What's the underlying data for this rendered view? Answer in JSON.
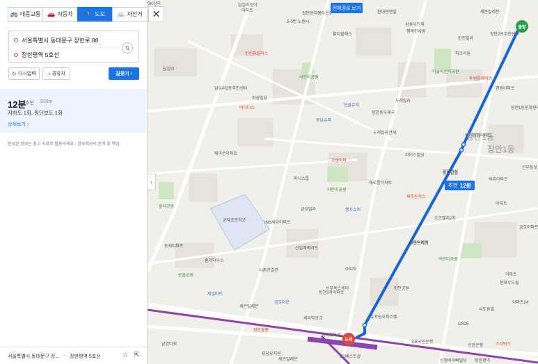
{
  "modes": [
    {
      "label": "대중교통",
      "icon": "bus-icon",
      "glyph": "🚌",
      "active": false
    },
    {
      "label": "자동차",
      "icon": "car-icon",
      "glyph": "🚗",
      "active": false
    },
    {
      "label": "도보",
      "icon": "walk-icon",
      "glyph": "🚶",
      "active": true
    },
    {
      "label": "자전거",
      "icon": "bicycle-icon",
      "glyph": "🚲",
      "active": false
    }
  ],
  "route": {
    "origin": "서울특별시 동대문구 장한로 88",
    "destination": "장한평역 5호선"
  },
  "buttons": {
    "reset": "다시입력",
    "waypoint": "경유지",
    "find": "길찾기"
  },
  "result": {
    "time": "12분",
    "recommended": "추천",
    "distance": "839m",
    "subtitle": "지하도 1회, 횡단보도 1회",
    "detail": "상세보기"
  },
  "notice": "안내된 정보는 참고 자료로 활용하세요 › 정보제공의 한계 및 책임",
  "footer": {
    "from": "서울특별시 동대문구 장...",
    "arrow": "→",
    "to": "장한평역 5호선"
  },
  "map": {
    "all_route_label": "전체경로 보기",
    "badge_rec": "추천",
    "badge_time": "12분",
    "start_label": "출발",
    "end_label": "도착",
    "district": "장안1동",
    "colors": {
      "route": "#1565d8",
      "subway_line5": "#8e44ad",
      "accent": "#1a73e8"
    },
    "labels": [
      {
        "text": "답십리동아",
        "cls": ""
      },
      {
        "text": "아파트",
        "cls": ""
      },
      {
        "text": "한신휴플러스",
        "cls": "red"
      },
      {
        "text": "장안현대홈타운1",
        "cls": ""
      },
      {
        "text": "현대썬앤빌",
        "cls": ""
      },
      {
        "text": "5-0번 노원시",
        "cls": ""
      },
      {
        "text": "황지클래스",
        "cls": ""
      },
      {
        "text": "삼성사진재",
        "cls": ""
      },
      {
        "text": "행복한사람",
        "cls": ""
      },
      {
        "text": "한진빌라",
        "cls": ""
      },
      {
        "text": "이솔어린이공원",
        "cls": "green"
      },
      {
        "text": "답십리",
        "cls": ""
      },
      {
        "text": "파크리움",
        "cls": ""
      },
      {
        "text": "세븐일레븐",
        "cls": ""
      },
      {
        "text": "장안2동주민센터",
        "cls": ""
      },
      {
        "text": "화성빌딩",
        "cls": ""
      },
      {
        "text": "어린이공원",
        "cls": "green"
      },
      {
        "text": "투썸플레이스",
        "cls": "red"
      },
      {
        "text": "정원아파트",
        "cls": ""
      },
      {
        "text": "답십리2동주민센터",
        "cls": ""
      },
      {
        "text": "아디다스",
        "cls": "red"
      },
      {
        "text": "단골슈퍼",
        "cls": "blue"
      },
      {
        "text": "장안동우체국",
        "cls": ""
      },
      {
        "text": "두레빌라",
        "cls": ""
      },
      {
        "text": "장안1동문화센터",
        "cls": ""
      },
      {
        "text": "동남슈퍼",
        "cls": "blue"
      },
      {
        "text": "두레빌라전세",
        "cls": ""
      },
      {
        "text": "장안한양아파트",
        "cls": ""
      },
      {
        "text": "장안1동",
        "cls": "big"
      },
      {
        "text": "제이슨아파트",
        "cls": ""
      },
      {
        "text": "리더스빌딩",
        "cls": ""
      },
      {
        "text": "오뎅어마",
        "cls": "red"
      },
      {
        "text": "해오름아파트",
        "cls": ""
      },
      {
        "text": "장안분성",
        "cls": ""
      },
      {
        "text": "미니스톱",
        "cls": ""
      },
      {
        "text": "어린이공원",
        "cls": "green"
      },
      {
        "text": "장안남빌",
        "cls": ""
      },
      {
        "text": "비쥬아파트",
        "cls": ""
      },
      {
        "text": "제주돈까스",
        "cls": "red"
      },
      {
        "text": "신부동장",
        "cls": ""
      },
      {
        "text": "쉼터공원",
        "cls": "green"
      },
      {
        "text": "군자초등학교",
        "cls": ""
      },
      {
        "text": "금성빌라",
        "cls": ""
      },
      {
        "text": "행자슈퍼",
        "cls": "blue"
      },
      {
        "text": "아파트",
        "cls": ""
      },
      {
        "text": "오크벨리2차",
        "cls": ""
      },
      {
        "text": "INS세타아파트",
        "cls": ""
      },
      {
        "text": "동재아파트",
        "cls": ""
      },
      {
        "text": "신일에버라트",
        "cls": ""
      },
      {
        "text": "풍림아이원",
        "cls": ""
      },
      {
        "text": "장안쓰레기",
        "cls": ""
      },
      {
        "text": "어린이공원",
        "cls": "green"
      },
      {
        "text": "금호아파트",
        "cls": ""
      },
      {
        "text": "홈가하우스",
        "cls": ""
      },
      {
        "text": "순돌공원",
        "cls": "green"
      },
      {
        "text": "사촌연결관",
        "cls": ""
      },
      {
        "text": "GS25",
        "cls": ""
      },
      {
        "text": "신부복스케이",
        "cls": ""
      },
      {
        "text": "장안2자아파트",
        "cls": ""
      },
      {
        "text": "장안공원",
        "cls": ""
      },
      {
        "text": "아파트",
        "cls": ""
      },
      {
        "text": "문화우드힐",
        "cls": ""
      },
      {
        "text": "제일마트",
        "cls": "blue"
      },
      {
        "text": "세븐일레븐",
        "cls": ""
      },
      {
        "text": "금호타운",
        "cls": "blue"
      },
      {
        "text": "이마트24",
        "cls": ""
      },
      {
        "text": "서도휴빌",
        "cls": ""
      },
      {
        "text": "GS25",
        "cls": ""
      },
      {
        "text": "장안돌빵",
        "cls": "red"
      },
      {
        "text": "세라믹공교",
        "cls": ""
      },
      {
        "text": "슈프림오피스텔",
        "cls": ""
      },
      {
        "text": "스타벅스",
        "cls": "red"
      },
      {
        "text": "남양타워",
        "cls": ""
      },
      {
        "text": "미라보타워",
        "cls": ""
      },
      {
        "text": "KB국민은행",
        "cls": ""
      },
      {
        "text": "신한은행",
        "cls": ""
      },
      {
        "text": "세븐일레븐",
        "cls": ""
      },
      {
        "text": "신정비아빠빌딩",
        "cls": ""
      },
      {
        "text": "LG베스트샵",
        "cls": ""
      },
      {
        "text": "장한평역",
        "cls": ""
      },
      {
        "text": "용답유치원",
        "cls": ""
      },
      {
        "text": "SK삼우",
        "cls": ""
      }
    ]
  }
}
